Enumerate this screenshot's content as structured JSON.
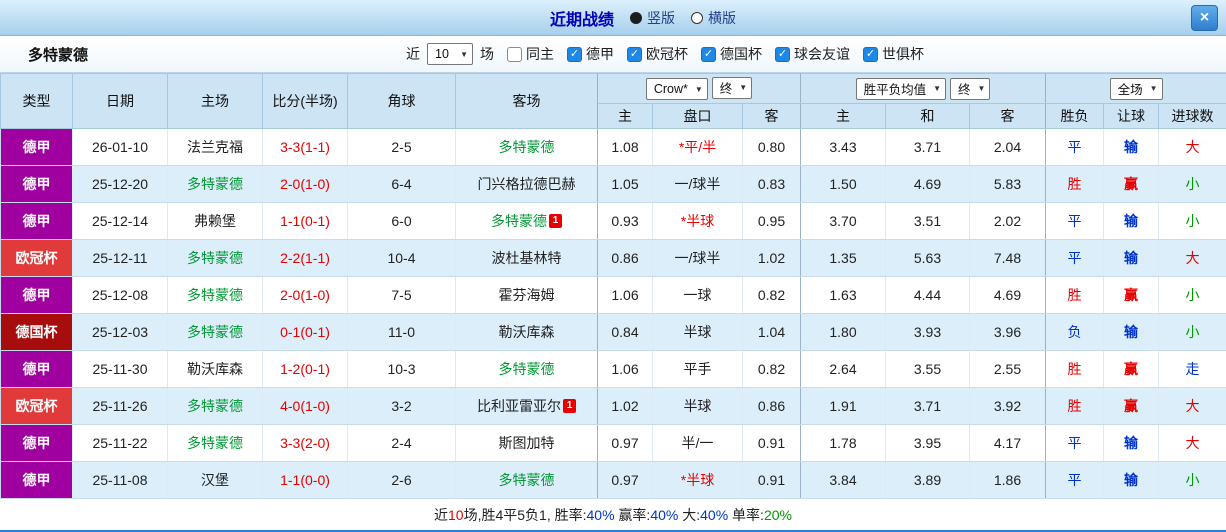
{
  "colors": {
    "red": "#e80000",
    "blue": "#0033cc",
    "green": "#009900",
    "black": "#222222"
  },
  "top_bar": {
    "title": "近期战绩",
    "vertical_label": "竖版",
    "horizontal_label": "横版",
    "close": "×"
  },
  "filter_bar": {
    "team": "多特蒙德",
    "near_label": "近",
    "count_value": "10",
    "matches_label": "场",
    "checkboxes": [
      {
        "label": "同主",
        "checked": false
      },
      {
        "label": "德甲",
        "checked": true
      },
      {
        "label": "欧冠杯",
        "checked": true
      },
      {
        "label": "德国杯",
        "checked": true
      },
      {
        "label": "球会友谊",
        "checked": true
      },
      {
        "label": "世俱杯",
        "checked": true
      }
    ]
  },
  "table": {
    "main_headers": [
      "类型",
      "日期",
      "主场",
      "比分(半场)",
      "角球",
      "客场"
    ],
    "selects": {
      "company": "Crow*",
      "company_final": "终",
      "avg": "胜平负均值",
      "avg_final": "终",
      "scope": "全场"
    },
    "sub_headers": [
      "主",
      "盘口",
      "客",
      "主",
      "和",
      "客",
      "胜负",
      "让球",
      "进球数"
    ],
    "rows": [
      {
        "league": "德甲",
        "league_color": "#a000a0",
        "date": "26-01-10",
        "home": "法兰克福",
        "home_dortmund": false,
        "home_badge": "",
        "score": "3-3(1-1)",
        "corners": "2-5",
        "away": "多特蒙德",
        "away_dortmund": true,
        "away_badge": "",
        "odds_home": "1.08",
        "handicap": "*平/半",
        "handicap_red": true,
        "odds_away": "0.80",
        "avg_home": "3.43",
        "avg_draw": "3.71",
        "avg_away": "2.04",
        "result": "平",
        "result_color": "blue",
        "give": "输",
        "give_color": "blue",
        "goals": "大",
        "goals_color": "red"
      },
      {
        "league": "德甲",
        "league_color": "#a000a0",
        "date": "25-12-20",
        "home": "多特蒙德",
        "home_dortmund": true,
        "home_badge": "",
        "score": "2-0(1-0)",
        "corners": "6-4",
        "away": "门兴格拉德巴赫",
        "away_dortmund": false,
        "away_badge": "",
        "odds_home": "1.05",
        "handicap": "一/球半",
        "handicap_red": false,
        "odds_away": "0.83",
        "avg_home": "1.50",
        "avg_draw": "4.69",
        "avg_away": "5.83",
        "result": "胜",
        "result_color": "red",
        "give": "赢",
        "give_color": "red",
        "goals": "小",
        "goals_color": "green"
      },
      {
        "league": "德甲",
        "league_color": "#a000a0",
        "date": "25-12-14",
        "home": "弗赖堡",
        "home_dortmund": false,
        "home_badge": "",
        "score": "1-1(0-1)",
        "corners": "6-0",
        "away": "多特蒙德",
        "away_dortmund": true,
        "away_badge": "1",
        "odds_home": "0.93",
        "handicap": "*半球",
        "handicap_red": true,
        "odds_away": "0.95",
        "avg_home": "3.70",
        "avg_draw": "3.51",
        "avg_away": "2.02",
        "result": "平",
        "result_color": "blue",
        "give": "输",
        "give_color": "blue",
        "goals": "小",
        "goals_color": "green"
      },
      {
        "league": "欧冠杯",
        "league_color": "#e03a3a",
        "date": "25-12-11",
        "home": "多特蒙德",
        "home_dortmund": true,
        "home_badge": "",
        "score": "2-2(1-1)",
        "corners": "10-4",
        "away": "波杜基林特",
        "away_dortmund": false,
        "away_badge": "",
        "odds_home": "0.86",
        "handicap": "一/球半",
        "handicap_red": false,
        "odds_away": "1.02",
        "avg_home": "1.35",
        "avg_draw": "5.63",
        "avg_away": "7.48",
        "result": "平",
        "result_color": "blue",
        "give": "输",
        "give_color": "blue",
        "goals": "大",
        "goals_color": "red"
      },
      {
        "league": "德甲",
        "league_color": "#a000a0",
        "date": "25-12-08",
        "home": "多特蒙德",
        "home_dortmund": true,
        "home_badge": "",
        "score": "2-0(1-0)",
        "corners": "7-5",
        "away": "霍芬海姆",
        "away_dortmund": false,
        "away_badge": "",
        "odds_home": "1.06",
        "handicap": "一球",
        "handicap_red": false,
        "odds_away": "0.82",
        "avg_home": "1.63",
        "avg_draw": "4.44",
        "avg_away": "4.69",
        "result": "胜",
        "result_color": "red",
        "give": "赢",
        "give_color": "red",
        "goals": "小",
        "goals_color": "green"
      },
      {
        "league": "德国杯",
        "league_color": "#a80d0d",
        "date": "25-12-03",
        "home": "多特蒙德",
        "home_dortmund": true,
        "home_badge": "",
        "score": "0-1(0-1)",
        "corners": "11-0",
        "away": "勒沃库森",
        "away_dortmund": false,
        "away_badge": "",
        "odds_home": "0.84",
        "handicap": "半球",
        "handicap_red": false,
        "odds_away": "1.04",
        "avg_home": "1.80",
        "avg_draw": "3.93",
        "avg_away": "3.96",
        "result": "负",
        "result_color": "blue",
        "give": "输",
        "give_color": "blue",
        "goals": "小",
        "goals_color": "green"
      },
      {
        "league": "德甲",
        "league_color": "#a000a0",
        "date": "25-11-30",
        "home": "勒沃库森",
        "home_dortmund": false,
        "home_badge": "",
        "score": "1-2(0-1)",
        "corners": "10-3",
        "away": "多特蒙德",
        "away_dortmund": true,
        "away_badge": "",
        "odds_home": "1.06",
        "handicap": "平手",
        "handicap_red": false,
        "odds_away": "0.82",
        "avg_home": "2.64",
        "avg_draw": "3.55",
        "avg_away": "2.55",
        "result": "胜",
        "result_color": "red",
        "give": "赢",
        "give_color": "red",
        "goals": "走",
        "goals_color": "blue"
      },
      {
        "league": "欧冠杯",
        "league_color": "#e03a3a",
        "date": "25-11-26",
        "home": "多特蒙德",
        "home_dortmund": true,
        "home_badge": "",
        "score": "4-0(1-0)",
        "corners": "3-2",
        "away": "比利亚雷亚尔",
        "away_dortmund": false,
        "away_badge": "1",
        "odds_home": "1.02",
        "handicap": "半球",
        "handicap_red": false,
        "odds_away": "0.86",
        "avg_home": "1.91",
        "avg_draw": "3.71",
        "avg_away": "3.92",
        "result": "胜",
        "result_color": "red",
        "give": "赢",
        "give_color": "red",
        "goals": "大",
        "goals_color": "red"
      },
      {
        "league": "德甲",
        "league_color": "#a000a0",
        "date": "25-11-22",
        "home": "多特蒙德",
        "home_dortmund": true,
        "home_badge": "",
        "score": "3-3(2-0)",
        "corners": "2-4",
        "away": "斯图加特",
        "away_dortmund": false,
        "away_badge": "",
        "odds_home": "0.97",
        "handicap": "半/一",
        "handicap_red": false,
        "odds_away": "0.91",
        "avg_home": "1.78",
        "avg_draw": "3.95",
        "avg_away": "4.17",
        "result": "平",
        "result_color": "blue",
        "give": "输",
        "give_color": "blue",
        "goals": "大",
        "goals_color": "red"
      },
      {
        "league": "德甲",
        "league_color": "#a000a0",
        "date": "25-11-08",
        "home": "汉堡",
        "home_dortmund": false,
        "home_badge": "",
        "score": "1-1(0-0)",
        "corners": "2-6",
        "away": "多特蒙德",
        "away_dortmund": true,
        "away_badge": "",
        "odds_home": "0.97",
        "handicap": "*半球",
        "handicap_red": true,
        "odds_away": "0.91",
        "avg_home": "3.84",
        "avg_draw": "3.89",
        "avg_away": "1.86",
        "result": "平",
        "result_color": "blue",
        "give": "输",
        "give_color": "blue",
        "goals": "小",
        "goals_color": "green"
      }
    ]
  },
  "summary": {
    "segments": [
      {
        "text": "近",
        "color": "black"
      },
      {
        "text": "10",
        "color": "red"
      },
      {
        "text": "场,胜4平5负1, 胜率:",
        "color": "black"
      },
      {
        "text": "40%",
        "color": "blue"
      },
      {
        "text": " 赢率:",
        "color": "black"
      },
      {
        "text": "40%",
        "color": "blue"
      },
      {
        "text": " 大:",
        "color": "black"
      },
      {
        "text": "40%",
        "color": "blue"
      },
      {
        "text": " 单率:",
        "color": "black"
      },
      {
        "text": "20%",
        "color": "green"
      }
    ]
  }
}
